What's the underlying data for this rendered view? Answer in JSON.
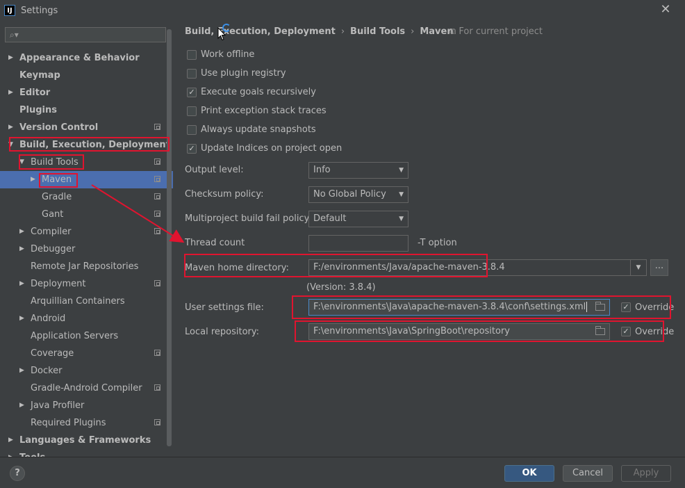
{
  "window": {
    "title": "Settings",
    "logo": "IJ"
  },
  "sidebar": {
    "search_placeholder": "",
    "items": [
      {
        "label": "Appearance & Behavior",
        "arrow": "▶"
      },
      {
        "label": "Keymap",
        "arrow": ""
      },
      {
        "label": "Editor",
        "arrow": "▶"
      },
      {
        "label": "Plugins",
        "arrow": ""
      },
      {
        "label": "Version Control",
        "arrow": "▶"
      },
      {
        "label": "Build, Execution, Deployment",
        "arrow": "▼"
      },
      {
        "label": "Build Tools",
        "arrow": "▼"
      },
      {
        "label": "Maven",
        "arrow": "▶"
      },
      {
        "label": "Gradle",
        "arrow": ""
      },
      {
        "label": "Gant",
        "arrow": ""
      },
      {
        "label": "Compiler",
        "arrow": "▶"
      },
      {
        "label": "Debugger",
        "arrow": "▶"
      },
      {
        "label": "Remote Jar Repositories",
        "arrow": ""
      },
      {
        "label": "Deployment",
        "arrow": "▶"
      },
      {
        "label": "Arquillian Containers",
        "arrow": ""
      },
      {
        "label": "Android",
        "arrow": "▶"
      },
      {
        "label": "Application Servers",
        "arrow": ""
      },
      {
        "label": "Coverage",
        "arrow": ""
      },
      {
        "label": "Docker",
        "arrow": "▶"
      },
      {
        "label": "Gradle-Android Compiler",
        "arrow": ""
      },
      {
        "label": "Java Profiler",
        "arrow": "▶"
      },
      {
        "label": "Required Plugins",
        "arrow": ""
      },
      {
        "label": "Languages & Frameworks",
        "arrow": "▶"
      },
      {
        "label": "Tools",
        "arrow": "▶"
      }
    ]
  },
  "main": {
    "breadcrumb": [
      "Build, Execution, Deployment",
      "Build Tools",
      "Maven"
    ],
    "breadcrumb_sep": "›",
    "for_project": "For current project",
    "checkboxes": [
      {
        "label": "Work offline",
        "checked": false
      },
      {
        "label": "Use plugin registry",
        "checked": false
      },
      {
        "label": "Execute goals recursively",
        "checked": true
      },
      {
        "label": "Print exception stack traces",
        "checked": false
      },
      {
        "label": "Always update snapshots",
        "checked": false
      },
      {
        "label": "Update Indices on project open",
        "checked": true
      }
    ],
    "output_level": {
      "label": "Output level:",
      "value": "Info"
    },
    "checksum_policy": {
      "label": "Checksum policy:",
      "value": "No Global Policy"
    },
    "multiproject": {
      "label": "Multiproject build fail policy:",
      "value": "Default"
    },
    "thread_count": {
      "label": "Thread count",
      "value": "",
      "suffix": "-T option"
    },
    "maven_home": {
      "label": "Maven home directory:",
      "value": "F:/environments/Java/apache-maven-3.8.4",
      "browse": "...",
      "version": "(Version: 3.8.4)"
    },
    "user_settings": {
      "label": "User settings file:",
      "value": "F:\\environments\\Java\\apache-maven-3.8.4\\conf\\settings.xml",
      "override": "Override"
    },
    "local_repo": {
      "label": "Local repository:",
      "value": "F:\\environments\\Java\\SpringBoot\\repository",
      "override": "Override"
    }
  },
  "footer": {
    "help": "?",
    "ok": "OK",
    "cancel": "Cancel",
    "apply": "Apply"
  },
  "colors": {
    "selection": "#4b6eaf",
    "annotation": "#e0142f",
    "background": "#3c3f41"
  }
}
